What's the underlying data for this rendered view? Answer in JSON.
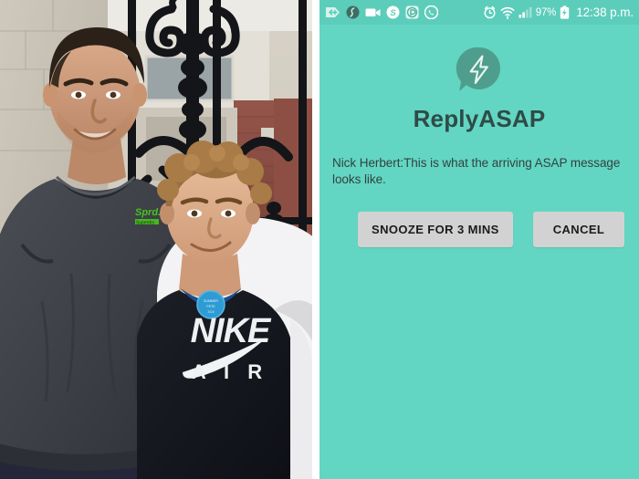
{
  "photo": {
    "alt": "Man in dark grey t-shirt standing with a boy in a black and white NIKE AIR raglan shirt in front of an ornate black iron gate",
    "subjects": [
      {
        "name": "adult-man",
        "shirt": "dark grey t-shirt with small green logo on chest"
      },
      {
        "name": "boy",
        "shirt": "black and white raglan shirt reading NIKE AIR with a blue round badge"
      }
    ],
    "shirt_text_line1": "NIKE",
    "shirt_text_line2": "AIR",
    "colors": {
      "man_shirt": "#3c3f44",
      "boy_shirt_black": "#14161c",
      "boy_shirt_white": "#f2f2f4",
      "gate_iron": "#131518",
      "wall_stone": "#c9c2b6",
      "brick": "#8a4b3c",
      "jeans": "#22263a",
      "badge_blue": "#2f9bd4"
    }
  },
  "phone": {
    "statusbar": {
      "icons_left": [
        {
          "name": "app-tag-plus-icon",
          "glyph": "tag-plus"
        },
        {
          "name": "squiggle-circle-icon",
          "glyph": "squiggle"
        },
        {
          "name": "video-camera-icon",
          "glyph": "camcorder"
        },
        {
          "name": "skype-icon",
          "glyph": "S"
        },
        {
          "name": "pushbullet-icon",
          "glyph": "P"
        },
        {
          "name": "whatsapp-icon",
          "glyph": "phone"
        }
      ],
      "icons_right": [
        {
          "name": "alarm-clock-icon",
          "glyph": "alarm"
        },
        {
          "name": "wifi-icon",
          "glyph": "wifi"
        },
        {
          "name": "cellular-signal-icon",
          "glyph": "bars"
        }
      ],
      "battery_percent": "97%",
      "battery_state": "charging",
      "clock": "12:38 p.m.",
      "background_color": "#5ccdba",
      "foreground_color": "#ffffff"
    },
    "dialog": {
      "logo_name": "replyasap-lightning-bubble-logo",
      "title": "ReplyASAP",
      "message": "Nick Herbert:This is what the arriving ASAP message looks like.",
      "buttons": [
        {
          "name": "snooze-button",
          "label": "SNOOZE FOR 3 MINS"
        },
        {
          "name": "cancel-button",
          "label": "CANCEL"
        }
      ],
      "background_color": "#62d6c2",
      "title_color": "#2f4b48",
      "logo_circle_color": "#4f9e8d",
      "button_color": "#d2d2d2"
    }
  }
}
